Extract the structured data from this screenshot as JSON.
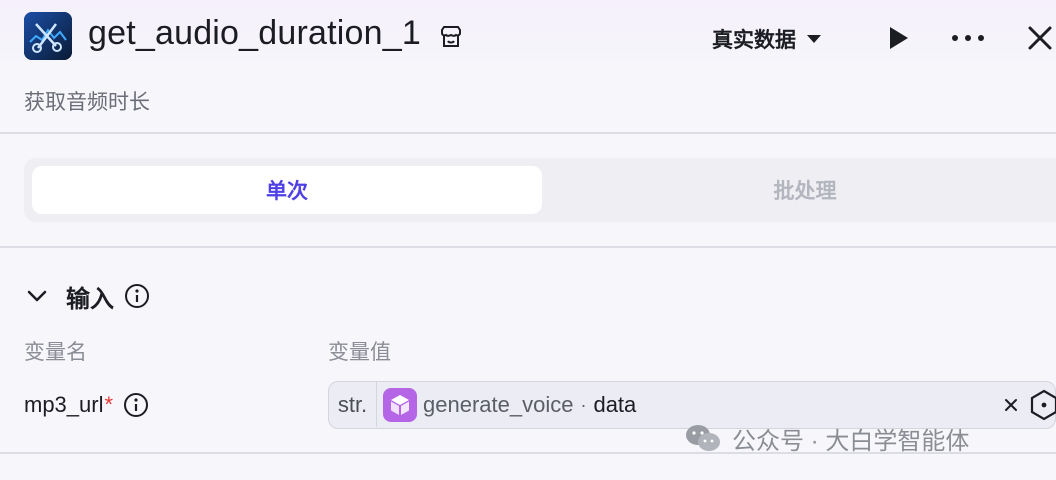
{
  "header": {
    "title": "get_audio_duration_1",
    "subtitle": "获取音频时长",
    "data_mode_label": "真实数据",
    "icons": [
      "app-node-icon",
      "store-tag-icon",
      "chevron-down-icon",
      "play-icon",
      "more-icon",
      "close-icon"
    ]
  },
  "tabs": [
    {
      "label": "单次",
      "active": true
    },
    {
      "label": "批处理",
      "active": false
    }
  ],
  "input_section": {
    "title": "输入",
    "col_name_header": "变量名",
    "col_value_header": "变量值",
    "rows": [
      {
        "name": "mp3_url",
        "required_mark": "*",
        "type_badge": "str.",
        "ref_node": "generate_voice",
        "ref_separator": "·",
        "ref_field": "data"
      }
    ]
  },
  "watermark": {
    "text": "公众号 · 大白学智能体"
  },
  "colors": {
    "accent": "#4e40e5",
    "required": "#e53935",
    "node_badge": "#b566e6"
  }
}
